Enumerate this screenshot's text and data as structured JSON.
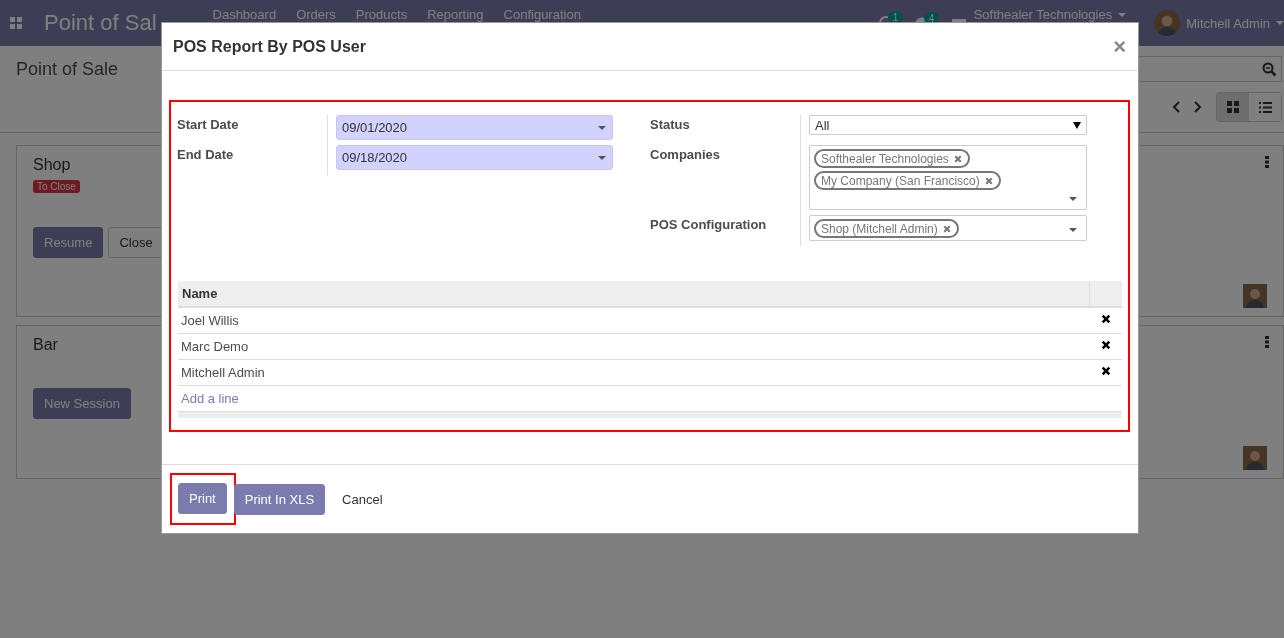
{
  "navbar": {
    "app_name": "Point of Sal",
    "menu": [
      "Dashboard",
      "Orders",
      "Products",
      "Reporting",
      "Configuration"
    ],
    "activity_count": "1",
    "message_count": "4",
    "company": "Softhealer Technologies",
    "user": "Mitchell Admin"
  },
  "control_panel": {
    "breadcrumb": "Point of Sale",
    "views": [
      {
        "kind": "kanban",
        "selected": true
      },
      {
        "kind": "list",
        "selected": false
      }
    ]
  },
  "cards": [
    {
      "name": "Shop",
      "badge": "To Close",
      "buttons": [
        {
          "label": "Resume",
          "kind": "primary"
        },
        {
          "label": "Close",
          "kind": "secondary"
        }
      ]
    },
    {
      "name": "Bar",
      "buttons": [
        {
          "label": "New Session",
          "kind": "primary"
        }
      ]
    }
  ],
  "dialog": {
    "title": "POS Report By POS User",
    "close": "×",
    "date_fields": [
      {
        "label": "Start Date",
        "value": "09/01/2020"
      },
      {
        "label": "End Date",
        "value": "09/18/2020"
      }
    ],
    "status": {
      "label": "Status",
      "value": "All"
    },
    "companies": {
      "label": "Companies",
      "tags": [
        "Softhealer Technologies",
        "My Company (San Francisco)"
      ]
    },
    "pos_configuration": {
      "label": "POS Configuration",
      "tags": [
        "Shop (Mitchell Admin)"
      ]
    },
    "table": {
      "columns": [
        "Name"
      ],
      "rows": [
        {
          "name": "Joel Willis"
        },
        {
          "name": "Marc Demo"
        },
        {
          "name": "Mitchell Admin"
        }
      ],
      "add_line": "Add a line"
    },
    "buttons": [
      {
        "label": "Print",
        "kind": "primary",
        "highlighted": true
      },
      {
        "label": "Print In XLS",
        "kind": "primary",
        "highlighted": false
      },
      {
        "label": "Cancel",
        "kind": "link",
        "highlighted": false
      }
    ]
  }
}
